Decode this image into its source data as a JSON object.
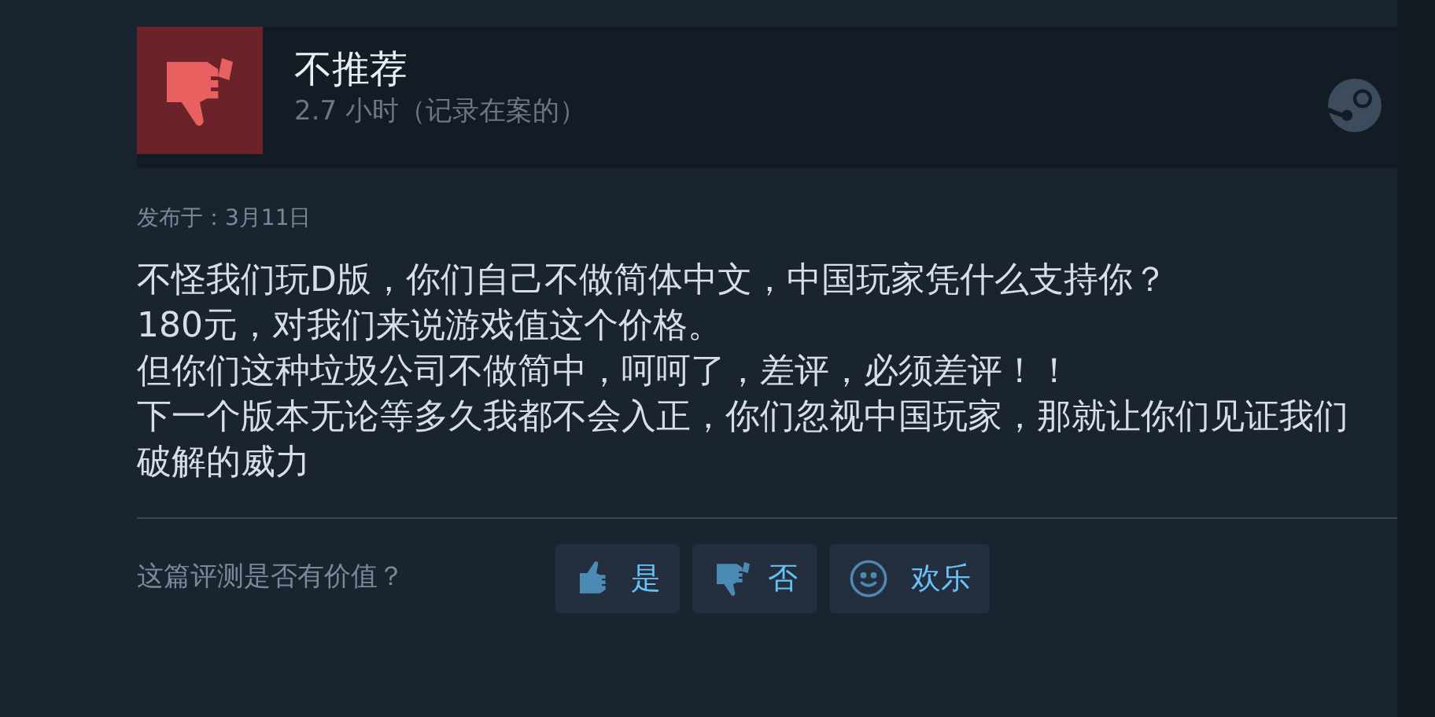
{
  "review": {
    "verdict": "不推荐",
    "recommended": false,
    "hours": "2.7 小时（记录在案的）",
    "posted": "发布于：3月11日",
    "paragraphs": [
      "不怪我们玩D版，你们自己不做简体中文，中国玩家凭什么支持你？",
      "180元，对我们来说游戏值这个价格。",
      "但你们这种垃圾公司不做简中，呵呵了，差评，必须差评！！",
      "下一个版本无论等多久我都不会入正，你们忽视中国玩家，那就让你们见证我们破解的威力"
    ]
  },
  "helpful": {
    "question": "这篇评测是否有价值？",
    "buttons": [
      {
        "kind": "yes",
        "label": "是"
      },
      {
        "kind": "no",
        "label": "否"
      },
      {
        "kind": "funny",
        "label": "欢乐"
      }
    ]
  }
}
